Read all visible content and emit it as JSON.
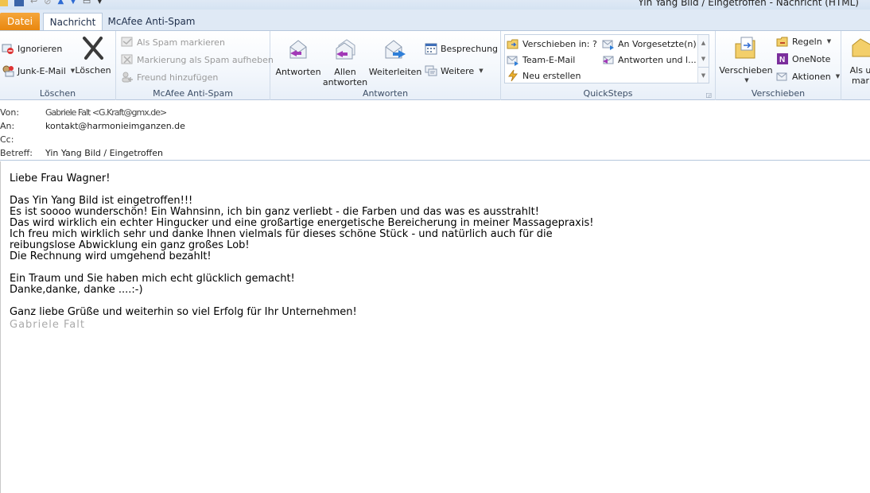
{
  "window": {
    "title": "Yin Yang Bild / Eingetroffen  -  Nachricht (HTML)"
  },
  "tabs": [
    {
      "label": "Datei"
    },
    {
      "label": "Nachricht"
    },
    {
      "label": "McAfee Anti-Spam"
    }
  ],
  "ribbon": {
    "loeschen": {
      "label": "Löschen",
      "ignorieren": "Ignorieren",
      "junk": "Junk-E-Mail",
      "loeschen_btn": "Löschen"
    },
    "mcafee": {
      "label": "McAfee Anti-Spam",
      "spam": "Als Spam markieren",
      "unmark": "Markierung als Spam aufheben",
      "friend": "Freund hinzufügen"
    },
    "antworten": {
      "label": "Antworten",
      "reply": "Antworten",
      "reply_all_1": "Allen",
      "reply_all_2": "antworten",
      "forward": "Weiterleiten",
      "meeting": "Besprechung",
      "more": "Weitere"
    },
    "quicksteps": {
      "label": "QuickSteps",
      "items": [
        "Verschieben in: ?",
        "An Vorgesetzte(n)",
        "Team-E-Mail",
        "Antworten und l...",
        "Neu erstellen"
      ]
    },
    "verschieben": {
      "label": "Verschieben",
      "move": "Verschieben",
      "rules": "Regeln",
      "onenote": "OneNote",
      "actions": "Aktionen"
    },
    "tags": {
      "label_1": "Als u",
      "label_2": "mar"
    }
  },
  "header": {
    "from_label": "Von:",
    "from_value": "Gabriele Falt <G.Kraft@gmx.de>",
    "to_label": "An:",
    "to_value": "kontakt@harmonieimganzen.de",
    "cc_label": "Cc:",
    "cc_value": "",
    "subject_label": "Betreff:",
    "subject_value": "Yin Yang Bild / Eingetroffen"
  },
  "body": {
    "text": "Liebe Frau Wagner!\n\nDas Yin Yang Bild ist eingetroffen!!!\nEs ist soooo wunderschön! Ein Wahnsinn, ich bin ganz verliebt - die Farben und das was es ausstrahlt!\nDas wird wirklich ein echter Hingucker und eine großartige energetische Bereicherung in meiner Massagepraxis!\nIch freu mich wirklich sehr und danke Ihnen vielmals für dieses schöne Stück - und natürlich auch für die\nreibungslose Abwicklung ein ganz großes Lob!\nDie Rechnung wird umgehend bezahlt!\n\nEin Traum und Sie haben mich echt glücklich gemacht!\nDanke,danke, danke ....:-)\n\nGanz liebe Grüße und weiterhin so viel Erfolg für Ihr Unternehmen!",
    "signature": "Gabriele Falt"
  }
}
